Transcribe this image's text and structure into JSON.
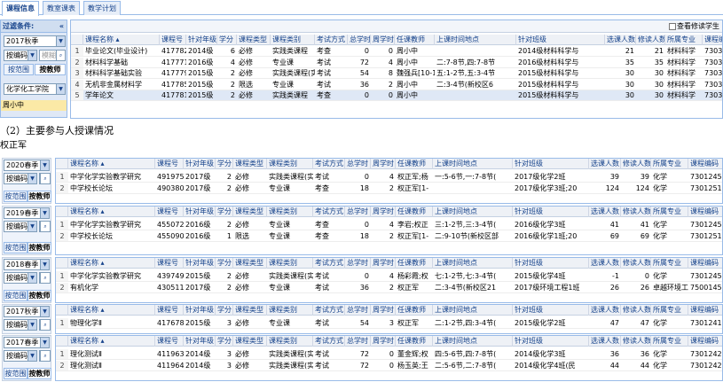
{
  "tabs": [
    "课程信息",
    "教室课表",
    "教学计划"
  ],
  "top": {
    "filter_title": "过滤条件:",
    "collapse": "«",
    "term": "2017秋季",
    "search_field": "按编码",
    "search_placeholder": "模糊",
    "btn_range": "按范围",
    "btn_teacher": "按教师",
    "dept": "化学化工学院",
    "teacher_list": [
      "周小中"
    ],
    "show_revised": "查看修读学生",
    "columns": [
      "",
      "课程名称 ▴",
      "课程号",
      "针对年级",
      "学分",
      "课程类型",
      "课程类别",
      "考试方式",
      "总学时",
      "周学时",
      "任课教师",
      "上课时间地点",
      "针对班级",
      "选课人数",
      "修读人数",
      "所属专业",
      "课程编码"
    ],
    "rows": [
      [
        "1",
        "毕业论文(毕业设计)",
        "417782",
        "2014级",
        "6",
        "必修",
        "实践类课程",
        "考查",
        "0",
        "0",
        "周小中",
        "",
        "2014级材料科学与",
        "21",
        "21",
        "材料科学",
        "73032450"
      ],
      [
        "2",
        "材料科学基础",
        "417771",
        "2016级",
        "4",
        "必修",
        "专业课",
        "考试",
        "72",
        "4",
        "周小中",
        "二:7-8节,四:7-8节",
        "2016级材料科学与",
        "35",
        "35",
        "材料科学",
        "73032403"
      ],
      [
        "3",
        "材料科学基础实验",
        "417779",
        "2015级",
        "2",
        "必修",
        "实践类课程(实",
        "考试",
        "54",
        "8",
        "魏强兵[10-18",
        "五:1-2节,五:3-4节",
        "2015级材料科学与",
        "30",
        "30",
        "材料科学",
        "73032425"
      ],
      [
        "4",
        "无机非金属材料学",
        "417785",
        "2015级",
        "2",
        "限选",
        "专业课",
        "考试",
        "36",
        "2",
        "周小中",
        "二:3-4节(新校区6",
        "2015级材料科学与",
        "30",
        "30",
        "材料科学",
        "73032510"
      ],
      [
        "5",
        "学年论文",
        "417781",
        "2015级",
        "2",
        "必修",
        "实践类课程",
        "考查",
        "0",
        "0",
        "周小中",
        "",
        "2015级材料科学与",
        "30",
        "30",
        "材料科学",
        "73032445"
      ]
    ]
  },
  "caption": "（2）主要参与人授课情况",
  "teacher_name": "权正军",
  "columns2": [
    "",
    "课程名称 ▴",
    "课程号",
    "针对年级",
    "学分",
    "课程类型",
    "课程类别",
    "考试方式",
    "总学时",
    "周学时",
    "任课教师",
    "上课时间地点",
    "针对班级",
    "选课人数",
    "修读人数",
    "所属专业",
    "课程编码"
  ],
  "panels": [
    {
      "term": "2020春季",
      "field": "按编码",
      "btn_range": "按范围",
      "btn_teacher": "按教师",
      "rows": [
        [
          "1",
          "中学化学实验教学研究",
          "491975",
          "2017级",
          "2",
          "必修",
          "实践类课程(实",
          "考试",
          "0",
          "4",
          "权正军;杨",
          "一:5-6节,一:7-8节(",
          "2017级化学2班",
          "39",
          "39",
          "化学",
          "7301245"
        ],
        [
          "2",
          "中学校长论坛",
          "490380",
          "2017级",
          "2",
          "必修",
          "专业课",
          "考查",
          "18",
          "2",
          "权正军[1-",
          "",
          "2017级化学3班;20",
          "124",
          "124",
          "化学",
          "7301251"
        ]
      ]
    },
    {
      "term": "2019春季",
      "field": "按编码",
      "btn_range": "按范围",
      "btn_teacher": "按教师",
      "rows": [
        [
          "1",
          "中学化学实验教学研究",
          "455072",
          "2016级",
          "2",
          "必修",
          "专业课",
          "考查",
          "0",
          "4",
          "李岩;权正",
          "三:1-2节,三:3-4节(",
          "2016级化学3班",
          "41",
          "41",
          "化学",
          "7301245"
        ],
        [
          "2",
          "中学校长论坛",
          "455090",
          "2016级",
          "1",
          "限选",
          "专业课",
          "考查",
          "18",
          "2",
          "权正军[1-",
          "二:9-10节(新校区部",
          "2016级化学1班;20",
          "69",
          "69",
          "化学",
          "7301251"
        ]
      ]
    },
    {
      "term": "2018春季",
      "field": "按编码",
      "btn_range": "按范围",
      "btn_teacher": "按教师",
      "rows": [
        [
          "1",
          "中学化学实验教学研究",
          "439749",
          "2015级",
          "2",
          "必修",
          "实践类课程(实",
          "考试",
          "0",
          "4",
          "杨彩霞;权",
          "七:1-2节,七:3-4节(",
          "2015级化学4班",
          "-1",
          "0",
          "化学",
          "7301245"
        ],
        [
          "2",
          "有机化学",
          "430511",
          "2017级",
          "2",
          "必修",
          "专业课",
          "考试",
          "36",
          "2",
          "权正军",
          "二:3-4节(新校区21",
          "2017级环境工程1班",
          "26",
          "26",
          "卓越环境工",
          "7500145"
        ]
      ]
    },
    {
      "term": "2017秋季",
      "field": "按编码",
      "btn_range": "按范围",
      "btn_teacher": "按教师",
      "rows": [
        [
          "1",
          "物理化学Ⅱ",
          "417678",
          "2015级",
          "3",
          "必修",
          "专业课",
          "考试",
          "54",
          "3",
          "权正军",
          "二:1-2节,四:3-4节(",
          "2015级化学2班",
          "47",
          "47",
          "化学",
          "7301241"
        ]
      ]
    },
    {
      "term": "2017春季",
      "field": "按编码",
      "btn_range": "按范围",
      "btn_teacher": "按教师",
      "rows": [
        [
          "1",
          "理化测试Ⅱ",
          "411963",
          "2014级",
          "3",
          "必修",
          "实践类课程(实",
          "考试",
          "72",
          "0",
          "董金辉;权",
          "四:5-6节,四:7-8节(",
          "2014级化学3班",
          "36",
          "36",
          "化学",
          "7301242"
        ],
        [
          "2",
          "理化测试Ⅱ",
          "411964",
          "2014级",
          "3",
          "必修",
          "实践类课程(实",
          "考试",
          "72",
          "0",
          "杨玉英;王",
          "二:5-6节,二:7-8节(",
          "2014级化学4班(民",
          "44",
          "44",
          "化学",
          "7301242"
        ]
      ]
    }
  ]
}
